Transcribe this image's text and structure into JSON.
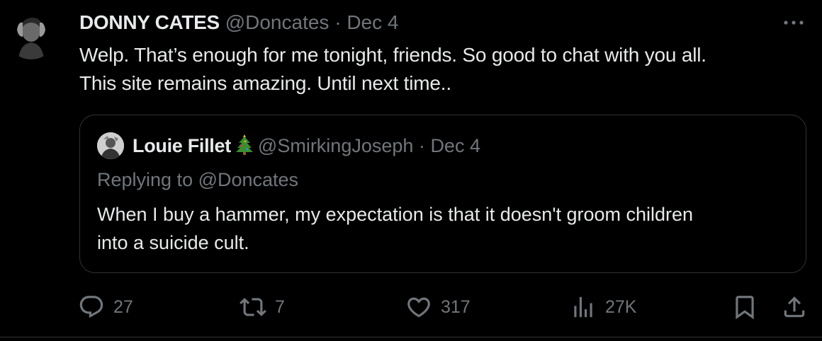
{
  "tweet": {
    "author_name": "DONNY CATES",
    "author_handle": "@Doncates",
    "separator": "·",
    "date": "Dec 4",
    "text_lines": [
      "Welp. That’s enough for me tonight, friends. So good to chat with you all.",
      "This site remains amazing. Until next time.."
    ],
    "more_icon": "more-horizontal-icon"
  },
  "quote": {
    "author_name": "Louie Fillet",
    "author_emoji": "christmas-tree-icon",
    "author_handle": "@SmirkingJoseph",
    "separator": "·",
    "date": "Dec 4",
    "replying_to": "Replying to @Doncates",
    "text_lines": [
      "When I buy a hammer, my expectation is that it doesn't groom children",
      "into a suicide cult."
    ]
  },
  "actions": {
    "replies": "27",
    "retweets": "7",
    "likes": "317",
    "views": "27K"
  },
  "colors": {
    "background": "#000000",
    "text": "#e7e9ea",
    "muted": "#71767b",
    "border": "#2f3336"
  }
}
